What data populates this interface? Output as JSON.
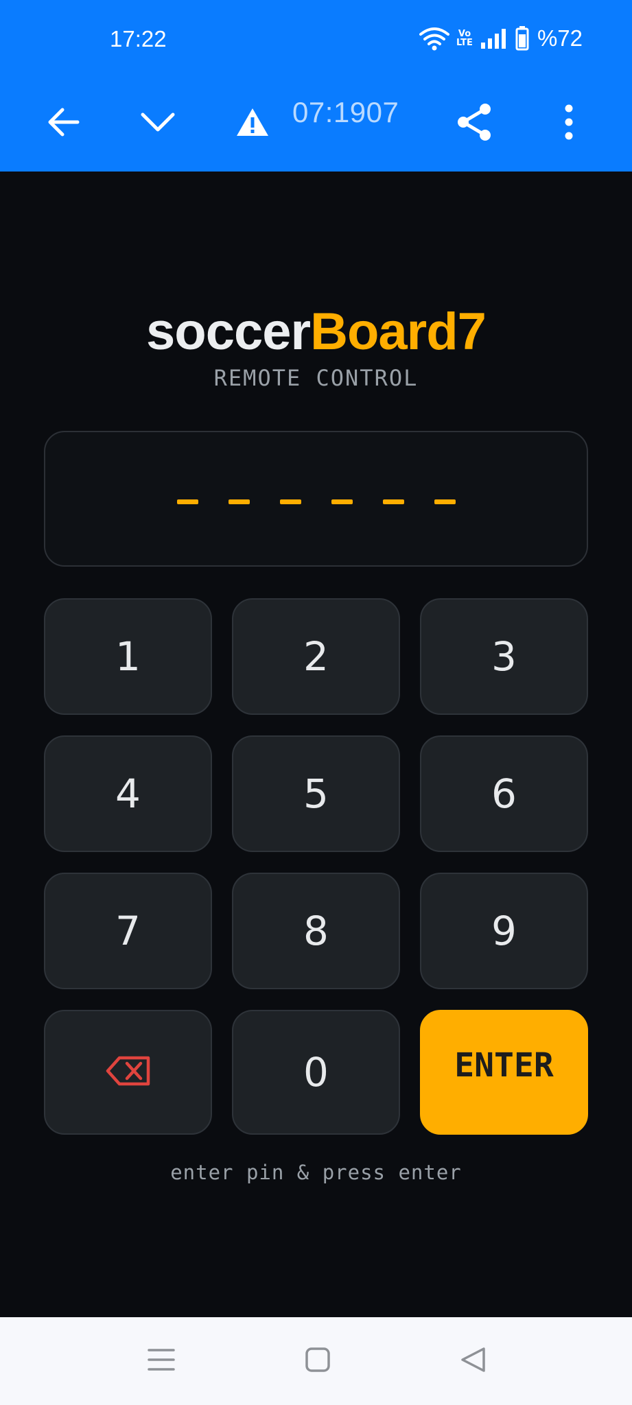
{
  "status_bar": {
    "time": "17:22",
    "battery": "%72",
    "network_label_top": "Vo",
    "network_label_bottom": "LTE"
  },
  "browser": {
    "url": "07:1907"
  },
  "app": {
    "brand_white": "soccer",
    "brand_orange": "Board7",
    "subtitle": "REMOTE CONTROL",
    "pin_dash_count": 6,
    "keys": {
      "k1": "1",
      "k2": "2",
      "k3": "3",
      "k4": "4",
      "k5": "5",
      "k6": "6",
      "k7": "7",
      "k8": "8",
      "k9": "9",
      "k0": "0",
      "enter": "ENTER"
    },
    "hint": "enter pin & press enter"
  },
  "colors": {
    "accent": "#ffae00",
    "chrome_blue": "#0a7cff",
    "background": "#0a0c10",
    "key_bg": "#1e2226",
    "backspace_red": "#e0443e"
  }
}
